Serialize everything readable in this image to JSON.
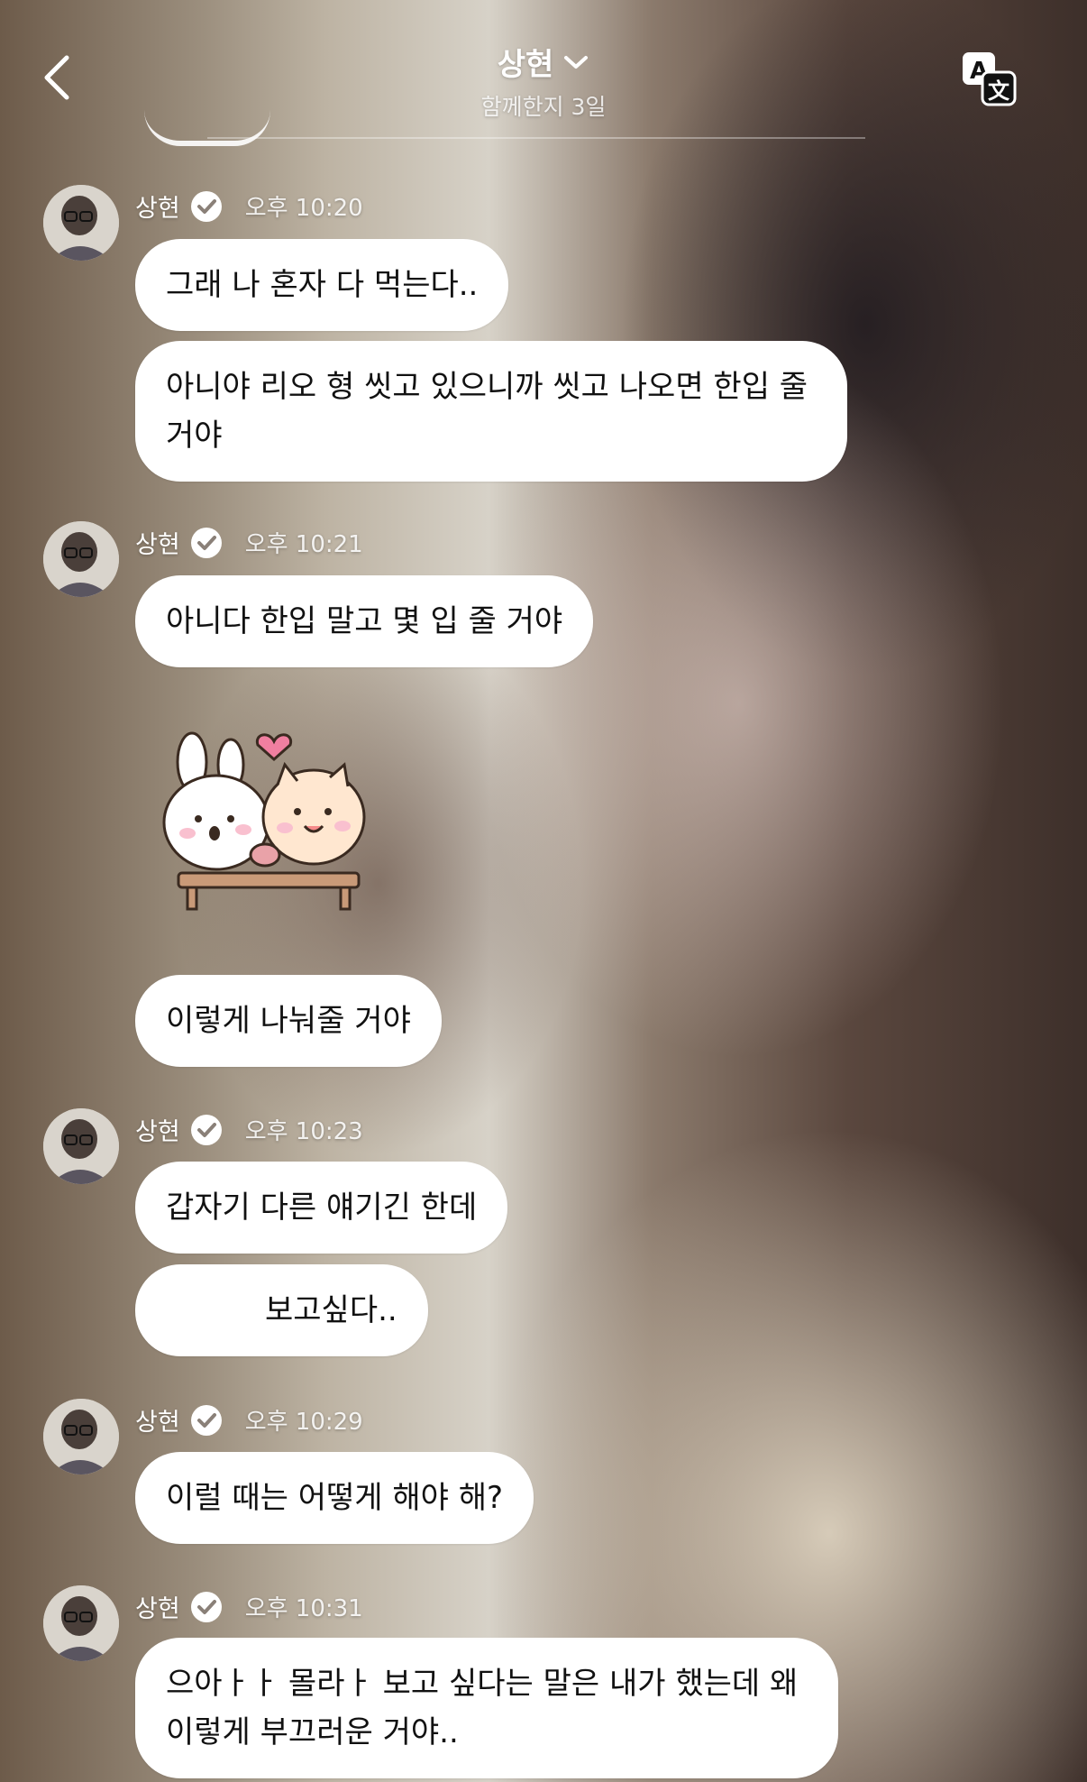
{
  "header": {
    "title": "상현",
    "subtitle": "함께한지 3일"
  },
  "messages": [
    {
      "sender": "상현",
      "time": "오후 10:20",
      "bubbles": [
        "그래 나 혼자 다 먹는다..",
        "아니야 리오 형 씻고 있으니까 씻고 나오면 한입 줄 거야"
      ]
    },
    {
      "sender": "상현",
      "time": "오후 10:21",
      "bubbles": [
        "아니다 한입 말고 몇 입 줄 거야",
        "이렇게 나눠줄 거야"
      ]
    },
    {
      "sender": "상현",
      "time": "오후 10:23",
      "bubbles": [
        "갑자기 다른 얘기긴 한데",
        "보고싶다.."
      ]
    },
    {
      "sender": "상현",
      "time": "오후 10:29",
      "bubbles": [
        "이럴 때는 어떻게 해야 해?"
      ]
    },
    {
      "sender": "상현",
      "time": "오후 10:31",
      "bubbles": [
        "으아ㅏㅏ 몰라ㅏ 보고 싶다는 말은 내가 했는데 왜 이렇게 부끄러운 거야.."
      ]
    }
  ],
  "colors": {
    "bubble_bg": "#ffffff",
    "heart": "#f07fa0",
    "verified": "#ffffff"
  },
  "icons": {
    "back": "chevron-left-icon",
    "dropdown": "chevron-down-icon",
    "translate": "translate-icon",
    "verified": "verified-badge-icon"
  }
}
